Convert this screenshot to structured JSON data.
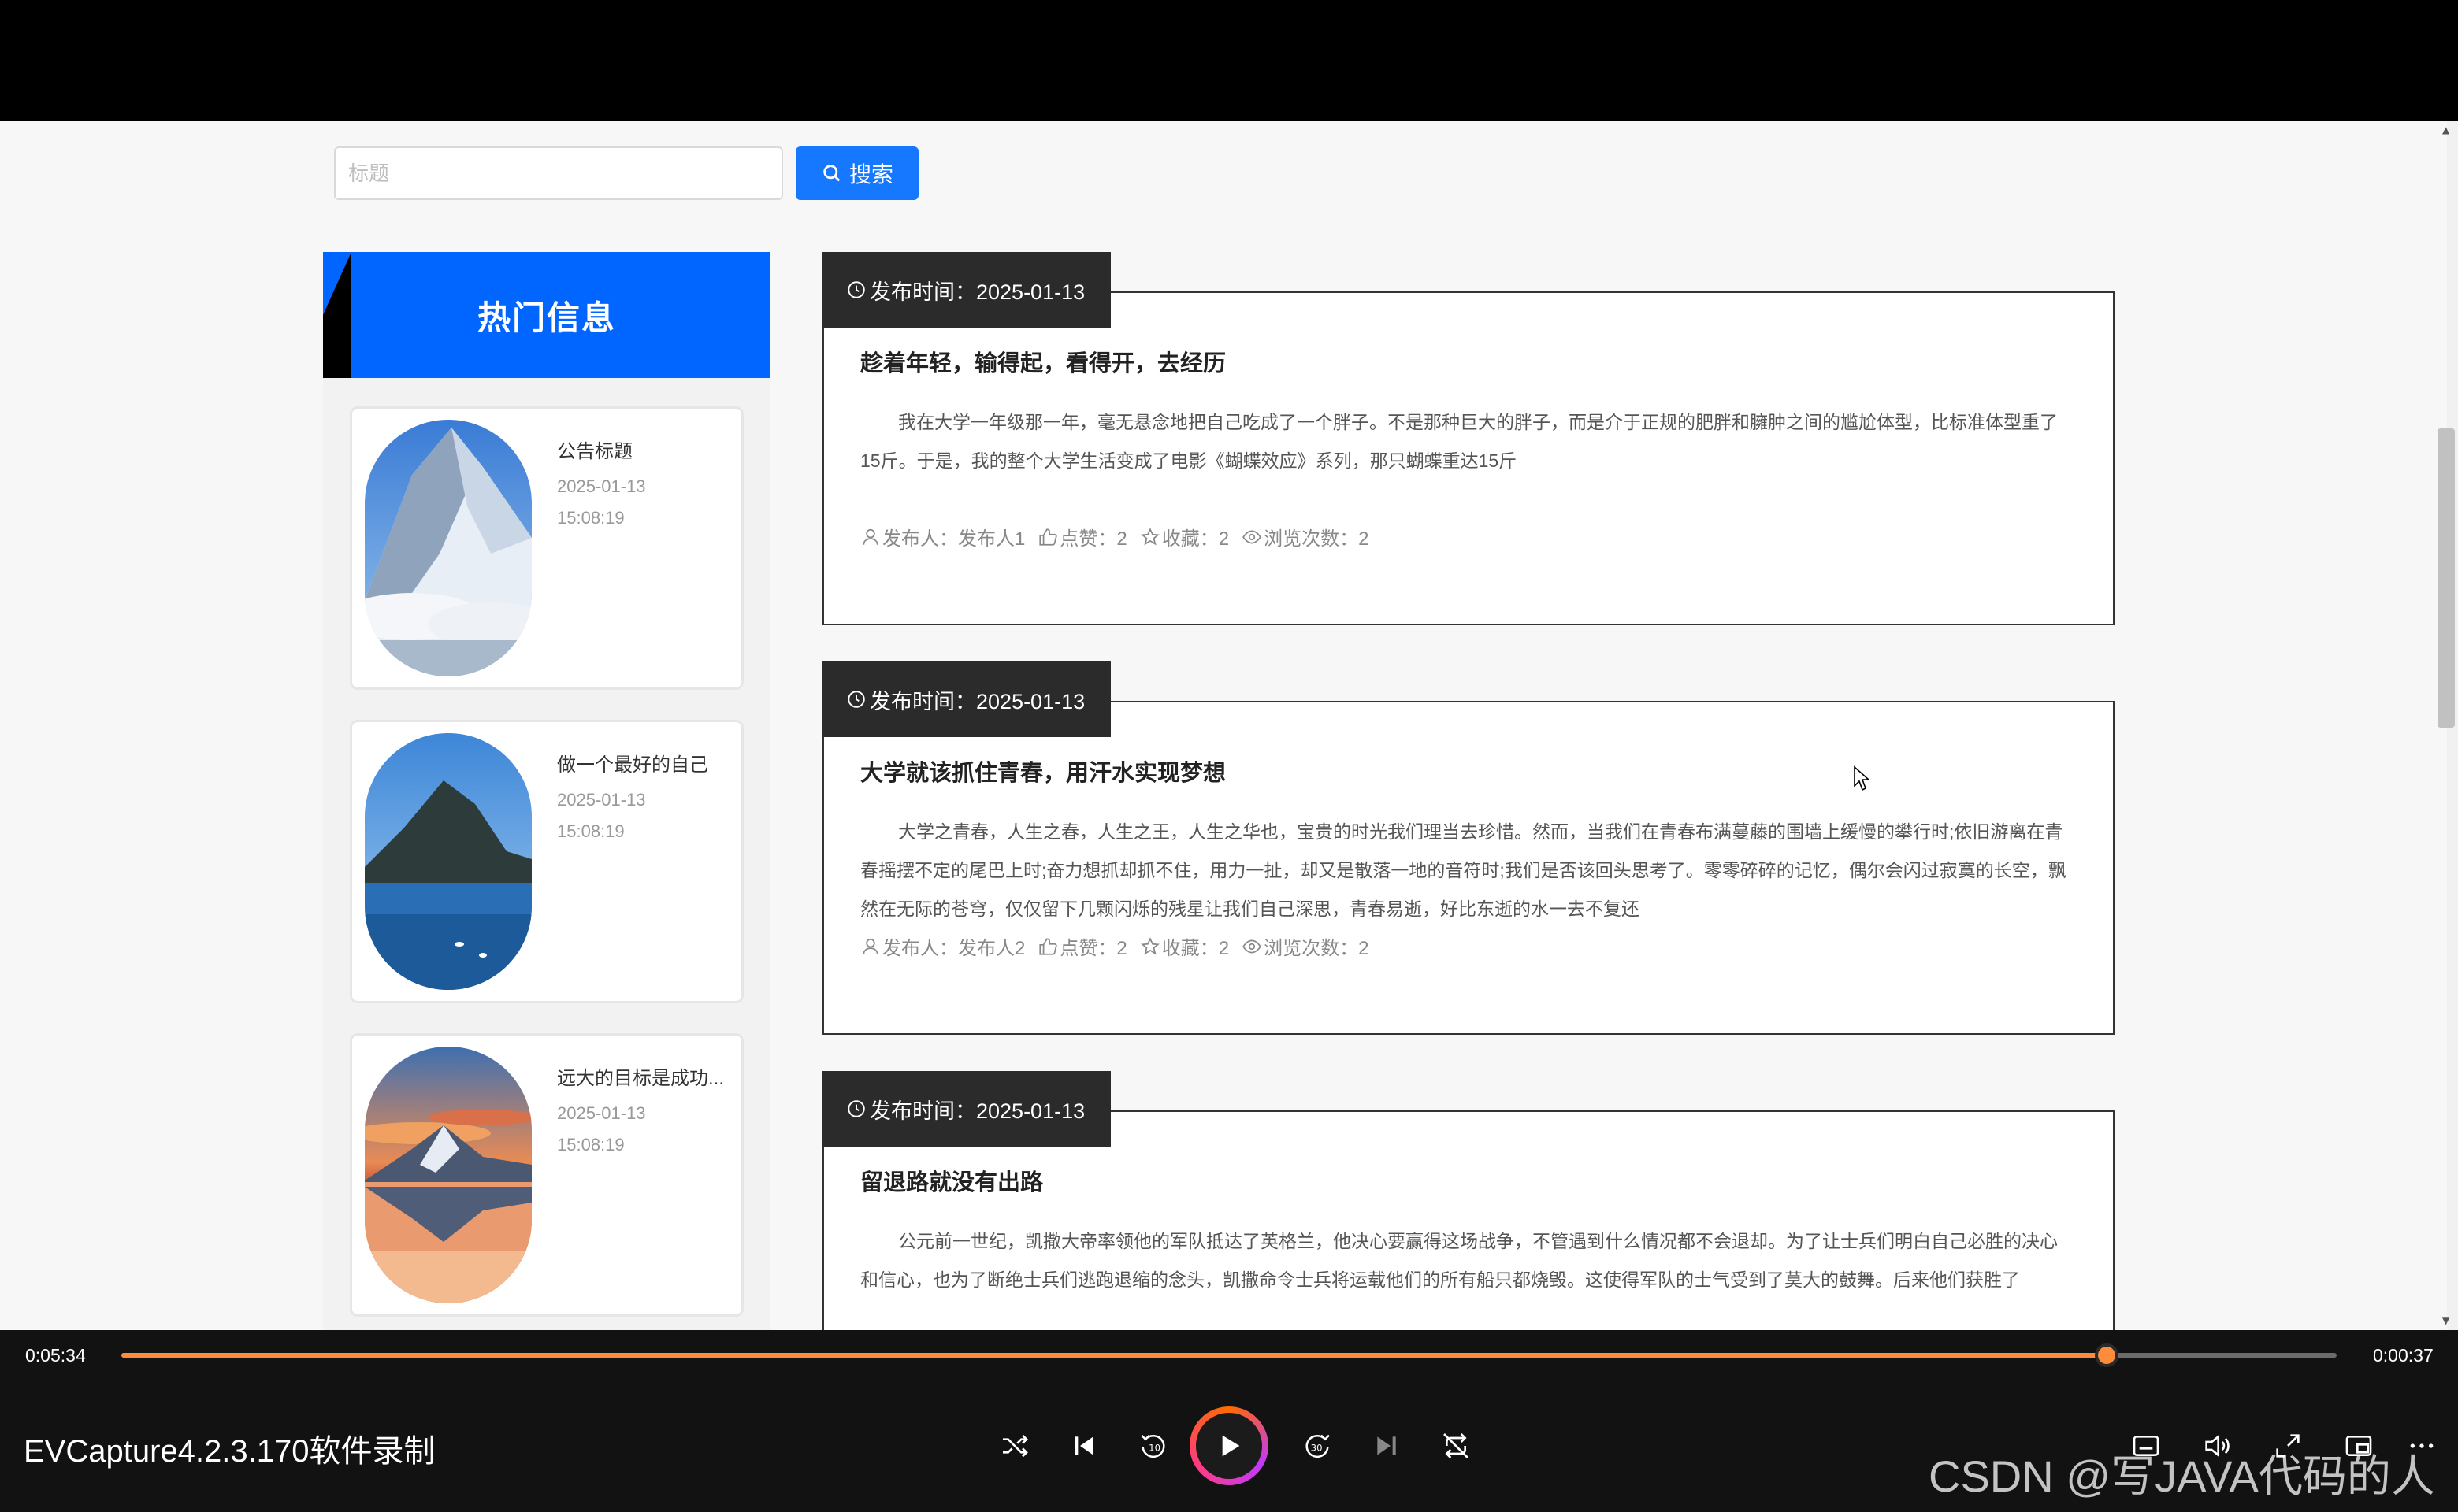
{
  "search": {
    "placeholder": "标题",
    "button_label": "搜索"
  },
  "sidebar": {
    "title": "热门信息",
    "items": [
      {
        "name": "公告标题",
        "date": "2025-01-13",
        "time": "15:08:19"
      },
      {
        "name": "做一个最好的自己",
        "date": "2025-01-13",
        "time": "15:08:19"
      },
      {
        "name": "远大的目标是成功...",
        "date": "2025-01-13",
        "time": "15:08:19"
      }
    ]
  },
  "articles": [
    {
      "tag": "发布时间：2025-01-13",
      "title": "趁着年轻，输得起，看得开，去经历",
      "body": "我在大学一年级那一年，毫无悬念地把自己吃成了一个胖子。不是那种巨大的胖子，而是介于正规的肥胖和臃肿之间的尴尬体型，比标准体型重了15斤。于是，我的整个大学生活变成了电影《蝴蝶效应》系列，那只蝴蝶重达15斤",
      "author": "发布人：发布人1",
      "likes": "点赞：2",
      "favorites": "收藏：2",
      "views": "浏览次数：2"
    },
    {
      "tag": "发布时间：2025-01-13",
      "title": "大学就该抓住青春，用汗水实现梦想",
      "body": "大学之青春，人生之春，人生之王，人生之华也，宝贵的时光我们理当去珍惜。然而，当我们在青春布满蔓藤的围墙上缓慢的攀行时;依旧游离在青春摇摆不定的尾巴上时;奋力想抓却抓不住，用力一扯，却又是散落一地的音符时;我们是否该回头思考了。零零碎碎的记忆，偶尔会闪过寂寞的长空，飘然在无际的苍穹，仅仅留下几颗闪烁的残星让我们自己深思，青春易逝，好比东逝的水一去不复还",
      "author": "发布人：发布人2",
      "likes": "点赞：2",
      "favorites": "收藏：2",
      "views": "浏览次数：2"
    },
    {
      "tag": "发布时间：2025-01-13",
      "title": "留退路就没有出路",
      "body": "公元前一世纪，凯撒大帝率领他的军队抵达了英格兰，他决心要赢得这场战争，不管遇到什么情况都不会退却。为了让士兵们明白自己必胜的决心和信心，也为了断绝士兵们逃跑退缩的念头，凯撒命令士兵将运载他们的所有船只都烧毁。这使得军队的士气受到了莫大的鼓舞。后来他们获胜了"
    }
  ],
  "player": {
    "elapsed": "0:05:34",
    "remaining": "0:00:37",
    "progress": 0.896,
    "title": "EVCapture4.2.3.170软件录制",
    "accent_color": "#ff8c3c"
  },
  "watermark": "CSDN @写JAVA代码的人"
}
